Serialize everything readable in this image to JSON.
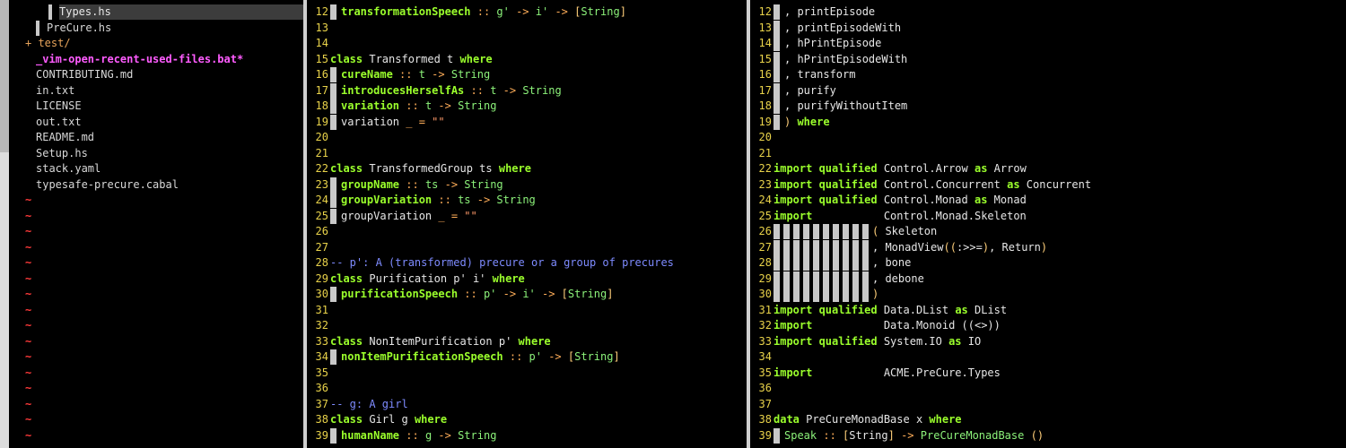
{
  "tree": {
    "items": [
      {
        "label": "Types.hs",
        "kind": "selected"
      },
      {
        "label": "PreCure.hs",
        "kind": "file"
      },
      {
        "label": "+ test/",
        "kind": "dir"
      },
      {
        "label": "_vim-open-recent-used-files.bat*",
        "kind": "modified"
      },
      {
        "label": "CONTRIBUTING.md",
        "kind": "file"
      },
      {
        "label": "in.txt",
        "kind": "file"
      },
      {
        "label": "LICENSE",
        "kind": "file"
      },
      {
        "label": "out.txt",
        "kind": "file"
      },
      {
        "label": "README.md",
        "kind": "file"
      },
      {
        "label": "Setup.hs",
        "kind": "file"
      },
      {
        "label": "stack.yaml",
        "kind": "file"
      },
      {
        "label": "typesafe-precure.cabal",
        "kind": "file"
      }
    ],
    "tilde": "~"
  },
  "middle": {
    "lines": [
      {
        "n": "12",
        "indent": true,
        "parts": [
          {
            "c": "fn",
            "t": "transformationSpeech"
          },
          {
            "c": "op",
            "t": " :: "
          },
          {
            "c": "id",
            "t": "g'"
          },
          {
            "c": "op",
            "t": " -> "
          },
          {
            "c": "id",
            "t": "i'"
          },
          {
            "c": "op",
            "t": " -> "
          },
          {
            "c": "brk",
            "t": "["
          },
          {
            "c": "id",
            "t": "String"
          },
          {
            "c": "brk",
            "t": "]"
          }
        ]
      },
      {
        "n": "13",
        "parts": []
      },
      {
        "n": "14",
        "parts": []
      },
      {
        "n": "15",
        "parts": [
          {
            "c": "kw",
            "t": "class "
          },
          {
            "c": "plain",
            "t": "Transformed t "
          },
          {
            "c": "kw",
            "t": "where"
          }
        ]
      },
      {
        "n": "16",
        "indent": true,
        "parts": [
          {
            "c": "fn",
            "t": "cureName"
          },
          {
            "c": "op",
            "t": " :: "
          },
          {
            "c": "id",
            "t": "t"
          },
          {
            "c": "op",
            "t": " -> "
          },
          {
            "c": "id",
            "t": "String"
          }
        ]
      },
      {
        "n": "17",
        "indent": true,
        "parts": [
          {
            "c": "fn",
            "t": "introducesHerselfAs"
          },
          {
            "c": "op",
            "t": " :: "
          },
          {
            "c": "id",
            "t": "t"
          },
          {
            "c": "op",
            "t": " -> "
          },
          {
            "c": "id",
            "t": "String"
          }
        ]
      },
      {
        "n": "18",
        "indent": true,
        "parts": [
          {
            "c": "fn",
            "t": "variation"
          },
          {
            "c": "op",
            "t": " :: "
          },
          {
            "c": "id",
            "t": "t"
          },
          {
            "c": "op",
            "t": " -> "
          },
          {
            "c": "id",
            "t": "String"
          }
        ]
      },
      {
        "n": "19",
        "indent": true,
        "parts": [
          {
            "c": "plain",
            "t": "variation "
          },
          {
            "c": "op",
            "t": "_ = "
          },
          {
            "c": "str",
            "t": "\"\""
          }
        ]
      },
      {
        "n": "20",
        "parts": []
      },
      {
        "n": "21",
        "parts": []
      },
      {
        "n": "22",
        "parts": [
          {
            "c": "kw",
            "t": "class "
          },
          {
            "c": "plain",
            "t": "TransformedGroup ts "
          },
          {
            "c": "kw",
            "t": "where"
          }
        ]
      },
      {
        "n": "23",
        "indent": true,
        "parts": [
          {
            "c": "fn",
            "t": "groupName"
          },
          {
            "c": "op",
            "t": " :: "
          },
          {
            "c": "id",
            "t": "ts"
          },
          {
            "c": "op",
            "t": " -> "
          },
          {
            "c": "id",
            "t": "String"
          }
        ]
      },
      {
        "n": "24",
        "indent": true,
        "parts": [
          {
            "c": "fn",
            "t": "groupVariation"
          },
          {
            "c": "op",
            "t": " :: "
          },
          {
            "c": "id",
            "t": "ts"
          },
          {
            "c": "op",
            "t": " -> "
          },
          {
            "c": "id",
            "t": "String"
          }
        ]
      },
      {
        "n": "25",
        "indent": true,
        "parts": [
          {
            "c": "plain",
            "t": "groupVariation "
          },
          {
            "c": "op",
            "t": "_ = "
          },
          {
            "c": "str",
            "t": "\"\""
          }
        ]
      },
      {
        "n": "26",
        "parts": []
      },
      {
        "n": "27",
        "parts": []
      },
      {
        "n": "28",
        "parts": [
          {
            "c": "cmt",
            "t": "-- p': A (transformed) precure or a group of precures"
          }
        ]
      },
      {
        "n": "29",
        "parts": [
          {
            "c": "kw",
            "t": "class "
          },
          {
            "c": "plain",
            "t": "Purification p' i' "
          },
          {
            "c": "kw",
            "t": "where"
          }
        ]
      },
      {
        "n": "30",
        "indent": true,
        "parts": [
          {
            "c": "fn",
            "t": "purificationSpeech"
          },
          {
            "c": "op",
            "t": " :: "
          },
          {
            "c": "id",
            "t": "p'"
          },
          {
            "c": "op",
            "t": " -> "
          },
          {
            "c": "id",
            "t": "i'"
          },
          {
            "c": "op",
            "t": " -> "
          },
          {
            "c": "brk",
            "t": "["
          },
          {
            "c": "id",
            "t": "String"
          },
          {
            "c": "brk",
            "t": "]"
          }
        ]
      },
      {
        "n": "31",
        "parts": []
      },
      {
        "n": "32",
        "parts": []
      },
      {
        "n": "33",
        "parts": [
          {
            "c": "kw",
            "t": "class "
          },
          {
            "c": "plain",
            "t": "NonItemPurification p' "
          },
          {
            "c": "kw",
            "t": "where"
          }
        ]
      },
      {
        "n": "34",
        "indent": true,
        "parts": [
          {
            "c": "fn",
            "t": "nonItemPurificationSpeech"
          },
          {
            "c": "op",
            "t": " :: "
          },
          {
            "c": "id",
            "t": "p'"
          },
          {
            "c": "op",
            "t": " -> "
          },
          {
            "c": "brk",
            "t": "["
          },
          {
            "c": "id",
            "t": "String"
          },
          {
            "c": "brk",
            "t": "]"
          }
        ]
      },
      {
        "n": "35",
        "parts": []
      },
      {
        "n": "36",
        "parts": []
      },
      {
        "n": "37",
        "parts": [
          {
            "c": "cmt",
            "t": "-- g: A girl"
          }
        ]
      },
      {
        "n": "38",
        "parts": [
          {
            "c": "kw",
            "t": "class "
          },
          {
            "c": "plain",
            "t": "Girl g "
          },
          {
            "c": "kw",
            "t": "where"
          }
        ]
      },
      {
        "n": "39",
        "indent": true,
        "parts": [
          {
            "c": "fn",
            "t": "humanName"
          },
          {
            "c": "op",
            "t": " :: "
          },
          {
            "c": "id",
            "t": "g"
          },
          {
            "c": "op",
            "t": " -> "
          },
          {
            "c": "id",
            "t": "String"
          }
        ]
      }
    ]
  },
  "right": {
    "lines": [
      {
        "n": "12",
        "indent": true,
        "parts": [
          {
            "c": "plain",
            "t": ", printEpisode"
          }
        ]
      },
      {
        "n": "13",
        "indent": true,
        "parts": [
          {
            "c": "plain",
            "t": ", printEpisodeWith"
          }
        ]
      },
      {
        "n": "14",
        "indent": true,
        "parts": [
          {
            "c": "plain",
            "t": ", hPrintEpisode"
          }
        ]
      },
      {
        "n": "15",
        "indent": true,
        "parts": [
          {
            "c": "plain",
            "t": ", hPrintEpisodeWith"
          }
        ]
      },
      {
        "n": "16",
        "indent": true,
        "parts": [
          {
            "c": "plain",
            "t": ", transform"
          }
        ]
      },
      {
        "n": "17",
        "indent": true,
        "parts": [
          {
            "c": "plain",
            "t": ", purify"
          }
        ]
      },
      {
        "n": "18",
        "indent": true,
        "parts": [
          {
            "c": "plain",
            "t": ", purifyWithoutItem"
          }
        ]
      },
      {
        "n": "19",
        "indent": true,
        "parts": [
          {
            "c": "brk",
            "t": ")"
          },
          {
            "c": "kw",
            "t": " where"
          }
        ]
      },
      {
        "n": "20",
        "parts": []
      },
      {
        "n": "21",
        "parts": []
      },
      {
        "n": "22",
        "parts": [
          {
            "c": "kw",
            "t": "import qualified "
          },
          {
            "c": "plain",
            "t": "Control.Arrow "
          },
          {
            "c": "kw",
            "t": "as "
          },
          {
            "c": "plain",
            "t": "Arrow"
          }
        ]
      },
      {
        "n": "23",
        "parts": [
          {
            "c": "kw",
            "t": "import qualified "
          },
          {
            "c": "plain",
            "t": "Control.Concurrent "
          },
          {
            "c": "kw",
            "t": "as "
          },
          {
            "c": "plain",
            "t": "Concurrent"
          }
        ]
      },
      {
        "n": "24",
        "parts": [
          {
            "c": "kw",
            "t": "import qualified "
          },
          {
            "c": "plain",
            "t": "Control.Monad "
          },
          {
            "c": "kw",
            "t": "as "
          },
          {
            "c": "plain",
            "t": "Monad"
          }
        ]
      },
      {
        "n": "25",
        "parts": [
          {
            "c": "kw",
            "t": "import           "
          },
          {
            "c": "plain",
            "t": "Control.Monad.Skeleton"
          }
        ]
      },
      {
        "n": "26",
        "blocks": 10,
        "parts": [
          {
            "c": "brk",
            "t": "( "
          },
          {
            "c": "plain",
            "t": "Skeleton"
          }
        ]
      },
      {
        "n": "27",
        "blocks": 10,
        "parts": [
          {
            "c": "plain",
            "t": ", MonadView"
          },
          {
            "c": "brk",
            "t": "(("
          },
          {
            "c": "plain",
            "t": ":>>="
          },
          {
            "c": "brk",
            "t": ")"
          },
          {
            "c": "plain",
            "t": ", Return"
          },
          {
            "c": "brk",
            "t": ")"
          }
        ]
      },
      {
        "n": "28",
        "blocks": 10,
        "parts": [
          {
            "c": "plain",
            "t": ", bone"
          }
        ]
      },
      {
        "n": "29",
        "blocks": 10,
        "parts": [
          {
            "c": "plain",
            "t": ", debone"
          }
        ]
      },
      {
        "n": "30",
        "blocks": 10,
        "parts": [
          {
            "c": "brk",
            "t": ")"
          }
        ]
      },
      {
        "n": "31",
        "parts": [
          {
            "c": "kw",
            "t": "import qualified "
          },
          {
            "c": "plain",
            "t": "Data.DList "
          },
          {
            "c": "kw",
            "t": "as "
          },
          {
            "c": "plain",
            "t": "DList"
          }
        ]
      },
      {
        "n": "32",
        "parts": [
          {
            "c": "kw",
            "t": "import           "
          },
          {
            "c": "plain",
            "t": "Data.Monoid ((<>))"
          }
        ]
      },
      {
        "n": "33",
        "parts": [
          {
            "c": "kw",
            "t": "import qualified "
          },
          {
            "c": "plain",
            "t": "System.IO "
          },
          {
            "c": "kw",
            "t": "as "
          },
          {
            "c": "plain",
            "t": "IO"
          }
        ]
      },
      {
        "n": "34",
        "parts": []
      },
      {
        "n": "35",
        "parts": [
          {
            "c": "kw",
            "t": "import           "
          },
          {
            "c": "plain",
            "t": "ACME.PreCure.Types"
          }
        ]
      },
      {
        "n": "36",
        "parts": []
      },
      {
        "n": "37",
        "parts": []
      },
      {
        "n": "38",
        "parts": [
          {
            "c": "kw",
            "t": "data "
          },
          {
            "c": "plain",
            "t": "PreCureMonadBase x "
          },
          {
            "c": "kw",
            "t": "where"
          }
        ]
      },
      {
        "n": "39",
        "indent": true,
        "parts": [
          {
            "c": "id",
            "t": "Speak"
          },
          {
            "c": "op",
            "t": " :: "
          },
          {
            "c": "brk",
            "t": "["
          },
          {
            "c": "plain",
            "t": "String"
          },
          {
            "c": "brk",
            "t": "]"
          },
          {
            "c": "op",
            "t": " -> "
          },
          {
            "c": "id",
            "t": "PreCureMonadBase "
          },
          {
            "c": "brk",
            "t": "()"
          }
        ]
      }
    ]
  }
}
